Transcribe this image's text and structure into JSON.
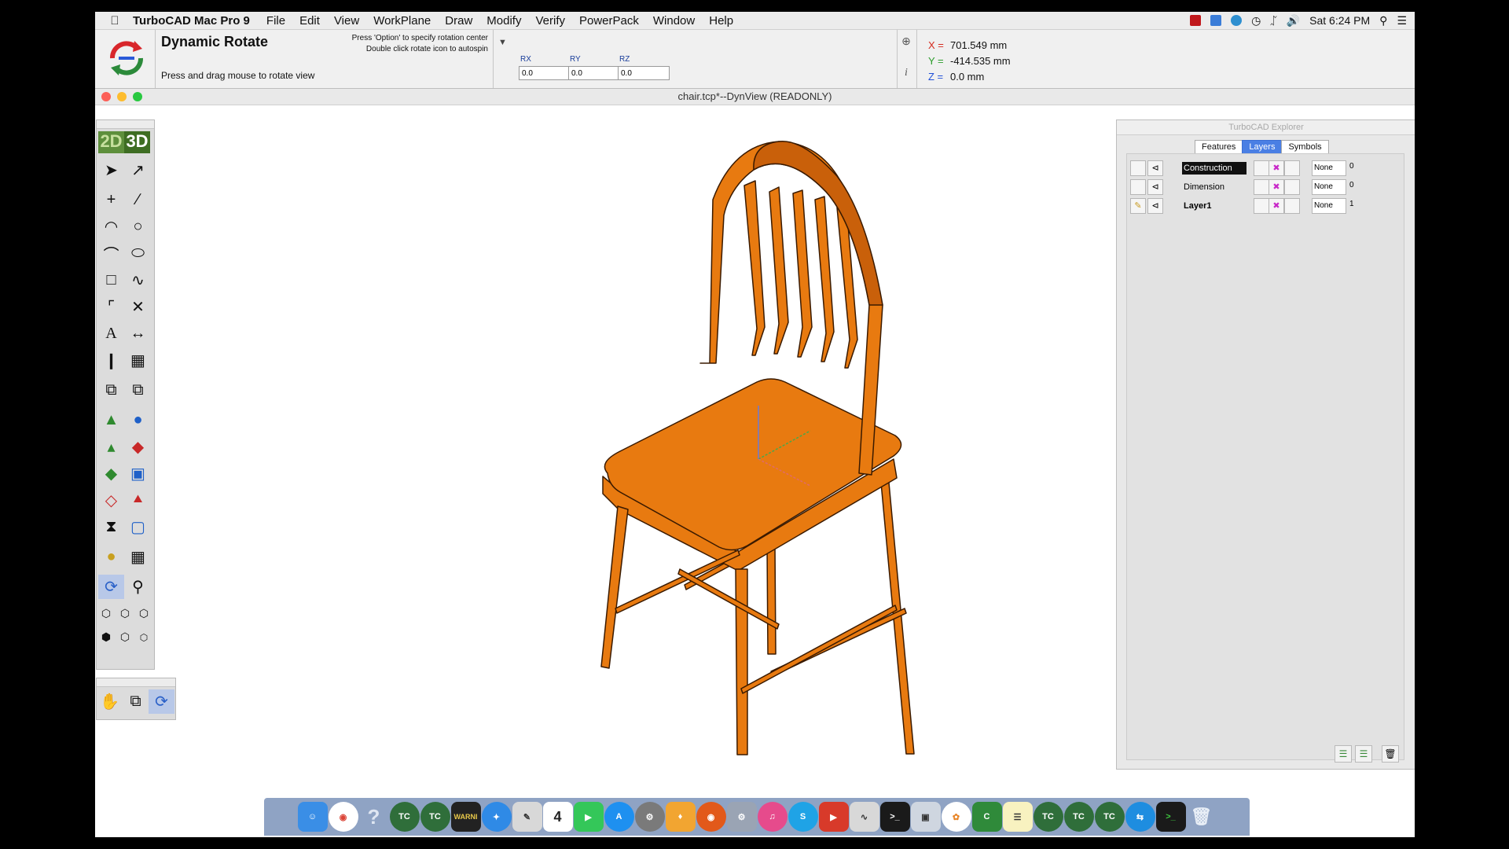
{
  "menubar": {
    "app_name": "TurboCAD Mac Pro 9",
    "items": [
      "File",
      "Edit",
      "View",
      "WorkPlane",
      "Draw",
      "Modify",
      "Verify",
      "PowerPack",
      "Window",
      "Help"
    ],
    "clock": "Sat 6:24 PM"
  },
  "tool": {
    "title": "Dynamic Rotate",
    "hint": "Press and drag mouse to rotate view",
    "tip1": "Press 'Option' to specify rotation center",
    "tip2": "Double click rotate icon to autospin",
    "rx_label": "RX",
    "ry_label": "RY",
    "rz_label": "RZ",
    "rx": "0.0",
    "ry": "0.0",
    "rz": "0.0"
  },
  "coords": {
    "x_label": "X =",
    "y_label": "Y =",
    "z_label": "Z =",
    "x": "701.549 mm",
    "y": "-414.535 mm",
    "z": "0.0 mm",
    "x_color": "#d42a1e",
    "y_color": "#2a9c2a",
    "z_color": "#1f4fd8"
  },
  "document": {
    "title": "chair.tcp*--DynView (READONLY)"
  },
  "palette": {
    "mode_2d": "2D",
    "mode_3d": "3D"
  },
  "explorer": {
    "title": "TurboCAD Explorer",
    "tabs": [
      "Features",
      "Layers",
      "Symbols"
    ],
    "active_tab": "Layers",
    "layers": [
      {
        "name": "Construction",
        "material": "None",
        "count": "0",
        "selected": true
      },
      {
        "name": "Dimension",
        "material": "None",
        "count": "0",
        "selected": false
      },
      {
        "name": "Layer1",
        "material": "None",
        "count": "1",
        "selected": false
      }
    ]
  },
  "colors": {
    "chair": "#e87a10",
    "chair_edge": "#3a1a00",
    "accent": "#4a7fe4"
  },
  "dock": {
    "items": [
      "finder-icon",
      "chrome-icon",
      "help-icon",
      "turbocad-icon",
      "turbocad-icon",
      "console-icon",
      "safari-icon",
      "preview-icon",
      "calendar-icon",
      "facetime-icon",
      "appstore-icon",
      "system-prefs-icon",
      "sketch-icon",
      "firefox-icon",
      "utility-icon",
      "itunes-icon",
      "skype-icon",
      "screenflick-icon",
      "grapher-icon",
      "terminal-icon",
      "screenshot-icon",
      "photos-icon",
      "camtasia-icon",
      "notes-icon",
      "turbocad-icon",
      "turbocad-icon",
      "turbocad-icon",
      "teamviewer-icon",
      "terminal-icon",
      "trash-icon"
    ],
    "calendar_day": "4",
    "console_text": "WARNI"
  }
}
